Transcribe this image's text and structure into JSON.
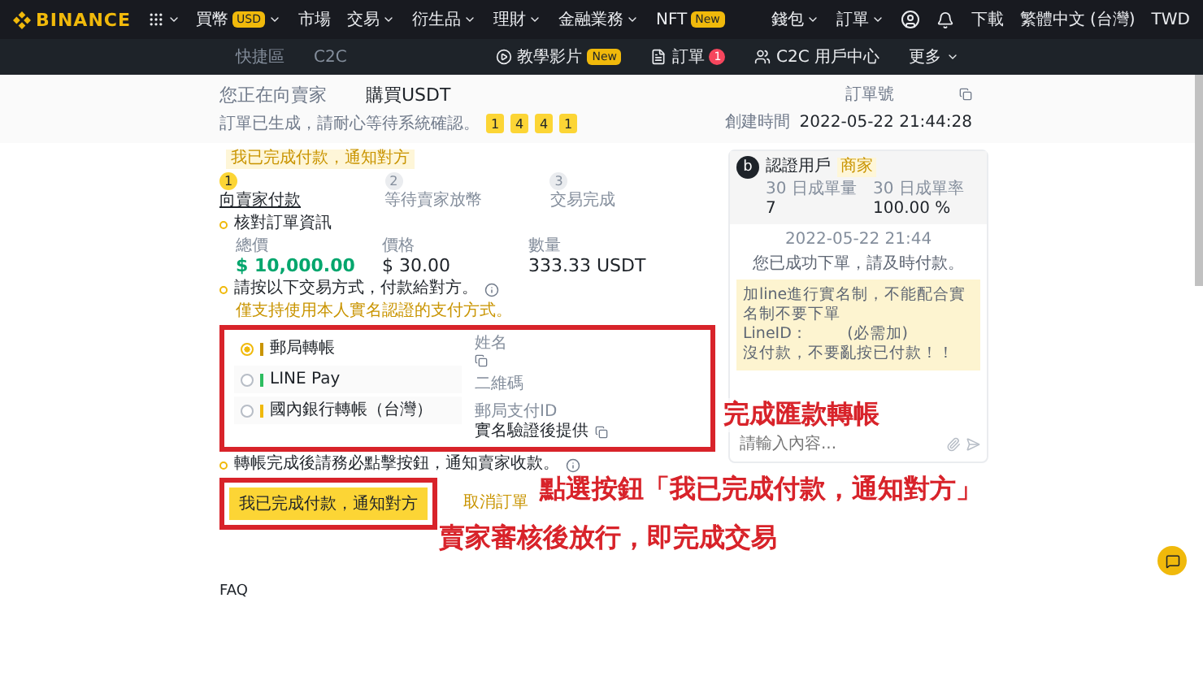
{
  "nav": {
    "brand": "BINANCE",
    "menu": [
      {
        "label": "買幣",
        "badge": "USD",
        "has_caret": true
      },
      {
        "label": "市場",
        "has_caret": false
      },
      {
        "label": "交易",
        "has_caret": true
      },
      {
        "label": "衍生品",
        "has_caret": true
      },
      {
        "label": "理財",
        "has_caret": true
      },
      {
        "label": "金融業務",
        "has_caret": true
      },
      {
        "label": "NFT",
        "badge": "New",
        "has_caret": false
      }
    ],
    "account": [
      {
        "label": "錢包",
        "has_caret": true
      },
      {
        "label": "訂單",
        "has_caret": true
      }
    ],
    "download": "下載",
    "language": "繁體中文 (台灣)",
    "currency": "TWD"
  },
  "subnav": {
    "links": [
      "快捷區",
      "C2C"
    ],
    "actions": [
      {
        "kind": "video",
        "label": "教學影片",
        "badge": "New"
      },
      {
        "kind": "orders",
        "label": "訂單",
        "count": "1"
      },
      {
        "kind": "center",
        "label": "C2C 用戶中心"
      },
      {
        "kind": "more",
        "label": "更多"
      }
    ]
  },
  "order": {
    "prefix": "您正在向賣家",
    "title": "購買USDT",
    "status": "訂單已生成，請耐心等待系統確認。",
    "countdown": [
      "1",
      "4",
      "4",
      "1"
    ],
    "order_no_label": "訂單號",
    "created_label": "創建時間",
    "created": "2022-05-22 21:44:28"
  },
  "steps": {
    "tooltip": "我已完成付款，通知對方",
    "items": [
      {
        "number": "1",
        "label": "向賣家付款",
        "selected": true
      },
      {
        "number": "2",
        "label": "等待賣家放幣",
        "selected": false
      },
      {
        "number": "3",
        "label": "交易完成",
        "selected": false
      }
    ]
  },
  "summary": {
    "heading": "核對訂單資訊",
    "fields": [
      {
        "label": "總價",
        "value": "$ 10,000.00",
        "highlight": true
      },
      {
        "label": "價格",
        "value": "$ 30.00",
        "highlight": false
      },
      {
        "label": "數量",
        "value": "333.33 USDT",
        "highlight": false
      }
    ]
  },
  "payment": {
    "heading": "請按以下交易方式，付款給對方。",
    "warning": "僅支持使用本人實名認證的支付方式。",
    "methods": [
      {
        "name": "郵局轉帳",
        "selected": true,
        "color": "#c99400"
      },
      {
        "name": "LINE Pay",
        "selected": false,
        "color": "#2dbd60"
      },
      {
        "name": "國內銀行轉帳（台灣）",
        "selected": false,
        "color": "#f0b90b"
      }
    ],
    "details": [
      {
        "label": "姓名",
        "copyable": true
      },
      {
        "label": "二維碼",
        "copyable": false
      },
      {
        "label": "郵局支付ID",
        "value": "實名驗證後提供",
        "copyable": true
      }
    ]
  },
  "notice": "轉帳完成後請務必點擊按鈕，通知賣家收款。",
  "confirm_button": "我已完成付款，通知對方",
  "cancel_link": "取消訂單",
  "faq": "FAQ",
  "chat": {
    "avatar": "b",
    "name": "認證用戶",
    "badge": "商家",
    "stats": [
      {
        "label": "30 日成單量",
        "value": "7"
      },
      {
        "label": "30 日成單率",
        "value": "100.00 %"
      }
    ],
    "timestamp": "2022-05-22 21:44",
    "system_message": "您已成功下單，請及時付款。",
    "message_lines": [
      "加line進行實名制，不能配合實名制不要下單",
      "LineID：        (必需加)",
      "沒付款，不要亂按已付款！！"
    ],
    "placeholder": "請輸入內容..."
  },
  "annotations": [
    {
      "text": "完成匯款轉帳"
    },
    {
      "text": "點選按鈕「我已完成付款，通知對方」"
    },
    {
      "text": "賣家審核後放行，即完成交易"
    }
  ]
}
